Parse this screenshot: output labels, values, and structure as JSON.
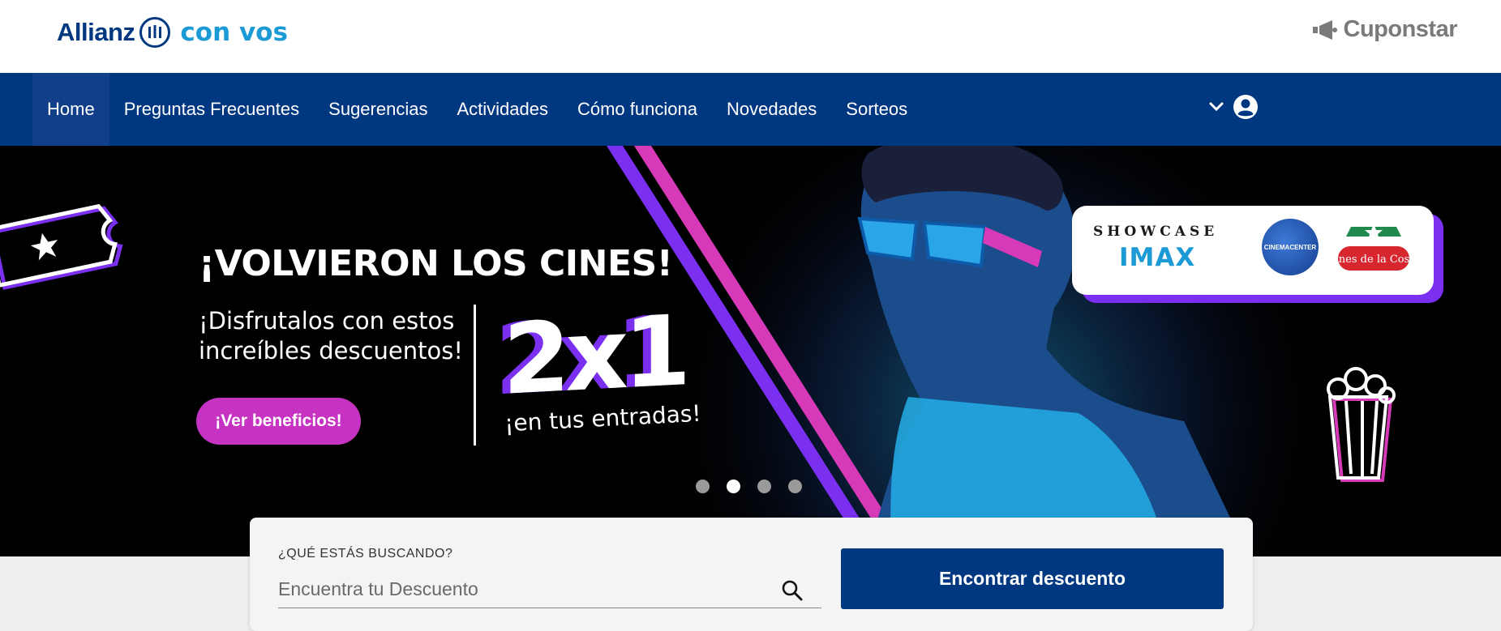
{
  "header": {
    "brand": "Allianz",
    "brand_suffix": "con vos",
    "partner_logo": "Cuponstar"
  },
  "nav": {
    "items": [
      {
        "label": "Home",
        "active": true
      },
      {
        "label": "Preguntas Frecuentes"
      },
      {
        "label": "Sugerencias"
      },
      {
        "label": "Actividades"
      },
      {
        "label": "Cómo funciona"
      },
      {
        "label": "Novedades"
      },
      {
        "label": "Sorteos"
      }
    ],
    "icons": [
      "chevron-down-icon",
      "user-circle-icon"
    ]
  },
  "hero": {
    "title": "¡VOLVIERON LOS CINES!",
    "subtitle": "¡Disfrutalos con estos increíbles descuentos!",
    "promo_big": "2x1",
    "promo_small": "¡en tus entradas!",
    "cta": "¡Ver beneficios!",
    "partners": {
      "showcase": "SHOWCASE",
      "imax": "IMAX",
      "cinemacenter": "CINEMACENTER",
      "cinesdelacosta": "Cines de la Costa"
    },
    "slides_total": 4,
    "slide_active": 2,
    "colors": {
      "accent_pink": "#c632c1",
      "accent_purple": "#7b2ff0",
      "nav_blue": "#003781"
    }
  },
  "search": {
    "label": "¿QUÉ ESTÁS BUSCANDO?",
    "placeholder": "Encuentra tu Descuento",
    "value": "",
    "button": "Encontrar descuento"
  }
}
